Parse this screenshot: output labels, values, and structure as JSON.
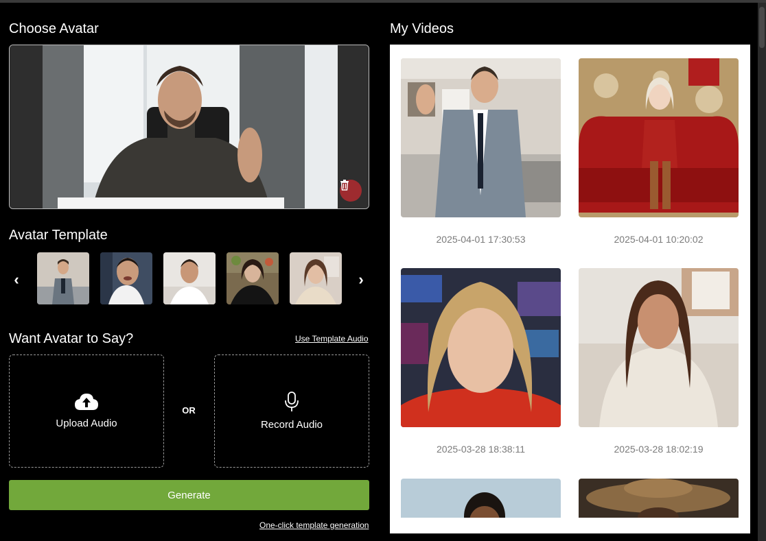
{
  "left": {
    "choose_title": "Choose Avatar",
    "template_title": "Avatar Template",
    "say_title": "Want Avatar to Say?",
    "use_template_audio": "Use Template Audio",
    "upload_label": "Upload Audio",
    "or_label": "OR",
    "record_label": "Record Audio",
    "generate_label": "Generate",
    "one_click_label": "One-click template generation",
    "prev_arrow": "‹",
    "next_arrow": "›"
  },
  "right": {
    "videos_title": "My Videos",
    "videos": [
      {
        "date": "2025-04-01 17:30:53"
      },
      {
        "date": "2025-04-01 10:20:02"
      },
      {
        "date": "2025-03-28 18:38:11"
      },
      {
        "date": "2025-03-28 18:02:19"
      }
    ]
  },
  "icons": {
    "delete": "trash-icon",
    "upload": "cloud-upload-icon",
    "record": "microphone-icon"
  },
  "colors": {
    "accent_green": "#72a83b",
    "delete_red": "#9e2b2f",
    "panel_bg": "#ffffff",
    "date_text": "#7a7a7a"
  }
}
